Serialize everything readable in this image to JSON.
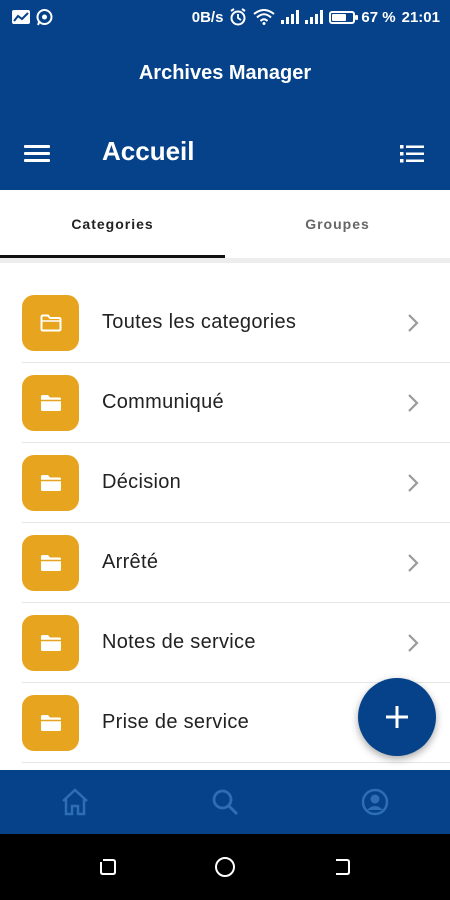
{
  "status_bar": {
    "speed": "0B/s",
    "battery_percent": "67 %",
    "battery_level": 0.67,
    "time": "21:01",
    "icons": [
      "chart-icon",
      "whatsapp-icon",
      "alarm-icon",
      "wifi-icon",
      "signal-icon",
      "signal-icon",
      "battery-icon"
    ]
  },
  "header": {
    "app_title": "Archives Manager",
    "page_title": "Accueil",
    "menu_icon": "hamburger-menu-icon",
    "view_icon": "list-view-icon"
  },
  "tabs": [
    {
      "label": "Categories",
      "active": true
    },
    {
      "label": "Groupes",
      "active": false
    }
  ],
  "categories": [
    {
      "label": "Toutes les categories",
      "icon": "folder-outline-icon"
    },
    {
      "label": "Communiqué",
      "icon": "folder-icon"
    },
    {
      "label": "Décision",
      "icon": "folder-icon"
    },
    {
      "label": "Arrêté",
      "icon": "folder-icon"
    },
    {
      "label": "Notes de service",
      "icon": "folder-icon"
    },
    {
      "label": "Prise de service",
      "icon": "folder-icon"
    }
  ],
  "fab": {
    "icon": "plus-icon"
  },
  "bottom_nav": [
    {
      "icon": "home-icon"
    },
    {
      "icon": "search-icon"
    },
    {
      "icon": "account-icon"
    }
  ],
  "system_nav": [
    {
      "icon": "recents-icon"
    },
    {
      "icon": "home-circle-icon"
    },
    {
      "icon": "back-icon"
    }
  ],
  "colors": {
    "primary": "#05428a",
    "folder": "#e7a41f",
    "nav_icon": "#2f6db3"
  }
}
